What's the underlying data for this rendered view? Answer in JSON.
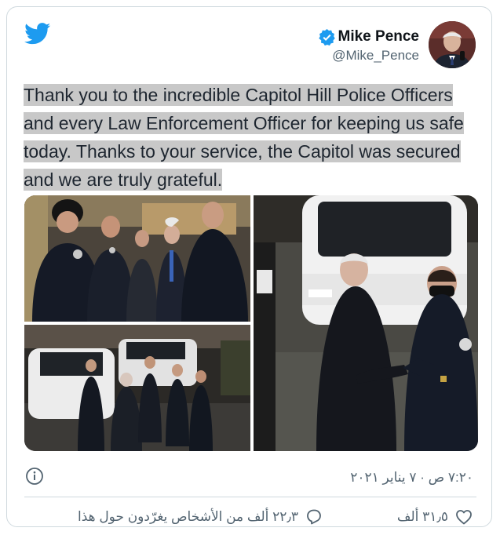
{
  "author": {
    "name": "Mike Pence",
    "handle": "@Mike_Pence"
  },
  "tweet": {
    "text": "Thank you to the incredible Capitol Hill Police Officers and every Law Enforcement Officer for keeping us safe today. Thanks to your service, the Capitol was secured and we are truly grateful."
  },
  "meta": {
    "timestamp": "٧:٢٠ ص · ٧ يناير ٢٠٢١"
  },
  "actions": {
    "likes": "٣١٫٥ ألف",
    "discussion": "٢٢٫٣ ألف من الأشخاص يغرّدون حول هذا"
  },
  "colors": {
    "twitter_blue": "#1d9bf0",
    "text_secondary": "#536471",
    "highlight": "#c8c8c8"
  },
  "icons": [
    "twitter-bird-icon",
    "verified-badge-icon",
    "info-icon",
    "heart-icon",
    "reply-bubble-icon"
  ]
}
